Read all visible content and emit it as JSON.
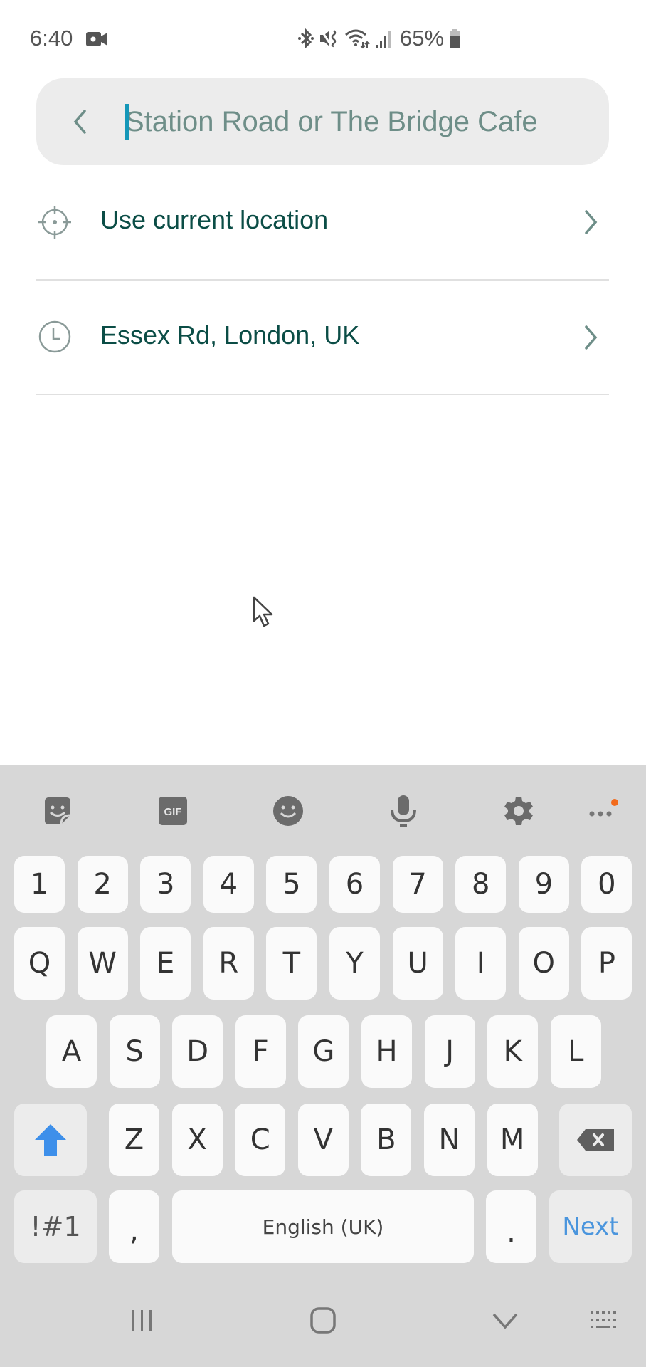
{
  "status_bar": {
    "time": "6:40",
    "battery_percent": "65%",
    "icons": [
      "screen-record-icon",
      "bluetooth-icon",
      "vibrate-mute-icon",
      "wifi-icon",
      "signal-icon",
      "battery-icon"
    ]
  },
  "search": {
    "placeholder": "Station Road or The Bridge Cafe",
    "value": "",
    "back_icon": "chevron-left-icon"
  },
  "list": [
    {
      "label": "Use current location",
      "icon": "crosshair-location-icon",
      "trailing_icon": "chevron-right-icon"
    },
    {
      "label": "Essex Rd, London, UK",
      "icon": "clock-history-icon",
      "trailing_icon": "chevron-right-icon"
    }
  ],
  "keyboard": {
    "toolbar": [
      "sticker-icon",
      "gif-icon",
      "emoji-icon",
      "microphone-icon",
      "settings-gear-icon",
      "more-options-icon"
    ],
    "gif_label": "GIF",
    "notification_dot_color": "#f26a1b",
    "rows": {
      "numbers": [
        "1",
        "2",
        "3",
        "4",
        "5",
        "6",
        "7",
        "8",
        "9",
        "0"
      ],
      "row1": [
        "Q",
        "W",
        "E",
        "R",
        "T",
        "Y",
        "U",
        "I",
        "O",
        "P"
      ],
      "row2": [
        "A",
        "S",
        "D",
        "F",
        "G",
        "H",
        "J",
        "K",
        "L"
      ],
      "row3": [
        "Z",
        "X",
        "C",
        "V",
        "B",
        "N",
        "M"
      ]
    },
    "symbols_label": "!#1",
    "comma_label": ",",
    "space_label": "English (UK)",
    "period_label": ".",
    "action_label": "Next",
    "accent_color": "#4a95dd"
  },
  "nav_bar": [
    "recent-apps-icon",
    "home-icon",
    "hide-keyboard-icon",
    "keyboard-switch-icon"
  ]
}
